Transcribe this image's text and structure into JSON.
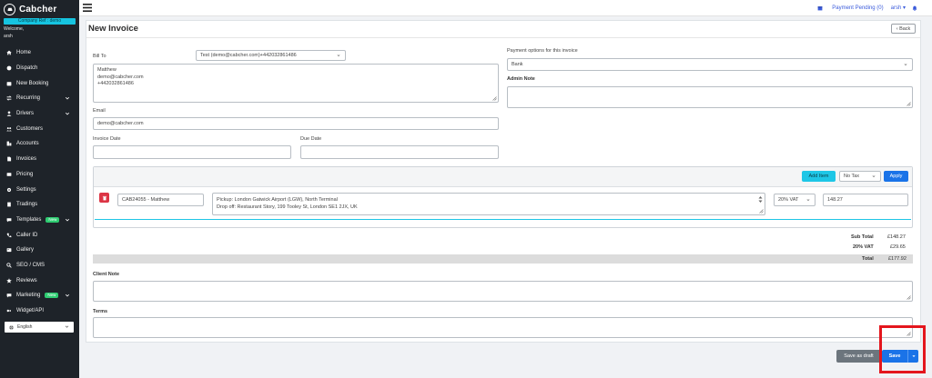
{
  "brand": {
    "name": "Cabcher"
  },
  "sidebar": {
    "company_ref": "Company Ref : demo",
    "welcome": "Welcome,",
    "username": "arsh",
    "items": [
      {
        "label": "Home",
        "icon": "home-icon"
      },
      {
        "label": "Dispatch",
        "icon": "dispatch-icon"
      },
      {
        "label": "New Booking",
        "icon": "new-booking-icon"
      },
      {
        "label": "Recurring",
        "icon": "recurring-icon",
        "has_children": true
      },
      {
        "label": "Drivers",
        "icon": "drivers-icon",
        "has_children": true
      },
      {
        "label": "Customers",
        "icon": "customers-icon"
      },
      {
        "label": "Accounts",
        "icon": "accounts-icon"
      },
      {
        "label": "Invoices",
        "icon": "invoices-icon"
      },
      {
        "label": "Pricing",
        "icon": "pricing-icon"
      },
      {
        "label": "Settings",
        "icon": "settings-icon"
      },
      {
        "label": "Tradings",
        "icon": "tradings-icon"
      },
      {
        "label": "Templates",
        "icon": "templates-icon",
        "badge": "New",
        "has_children": true
      },
      {
        "label": "Caller ID",
        "icon": "caller-id-icon"
      },
      {
        "label": "Gallery",
        "icon": "gallery-icon"
      },
      {
        "label": "SEO / CMS",
        "icon": "seo-icon"
      },
      {
        "label": "Reviews",
        "icon": "reviews-icon"
      },
      {
        "label": "Marketing",
        "icon": "marketing-icon",
        "badge": "New",
        "has_children": true
      },
      {
        "label": "Widget/API",
        "icon": "widget-icon"
      }
    ],
    "language": "English"
  },
  "topbar": {
    "payment_pending": "Payment Pending (0)",
    "user": "arsh"
  },
  "page": {
    "title": "New Invoice",
    "back_label": "Back"
  },
  "form": {
    "bill_to_label": "Bill To",
    "bill_to_value": "Test (demo@cabcher.com)+442032861486",
    "address_lines": [
      "Matthew",
      "demo@cabcher.com",
      "+442032861486"
    ],
    "email_label": "Email",
    "email_value": "demo@cabcher.com",
    "invoice_date_label": "Invoice Date",
    "invoice_date_value": "",
    "due_date_label": "Due Date",
    "due_date_value": "",
    "payment_options_label": "Payment options for this invoice",
    "payment_option_value": "Bank",
    "admin_note_label": "Admin Note",
    "admin_note_value": ""
  },
  "items": {
    "add_item_label": "Add Item",
    "tax_select_value": "No Tax",
    "apply_label": "Apply",
    "rows": [
      {
        "ref": "CAB24055 - Matthew",
        "description": [
          "Pickup: London Gatwick Airport (LGW), North Terminal",
          "Drop off: Restaurant Story, 199 Tooley St, London SE1 2JX, UK"
        ],
        "vat": "20% VAT",
        "amount": "148.27"
      }
    ]
  },
  "totals": {
    "subtotal_label": "Sub Total",
    "subtotal_value": "£148.27",
    "vat_label": "20% VAT",
    "vat_value": "£29.65",
    "total_label": "Total",
    "total_value": "£177.92"
  },
  "notes": {
    "client_note_label": "Client Note",
    "terms_label": "Terms"
  },
  "actions": {
    "save_draft_label": "Save as draft",
    "save_label": "Save"
  },
  "colors": {
    "sidebar_bg": "#1e2329",
    "accent_cyan": "#1ec6e6",
    "primary_blue": "#1a73e8",
    "highlight_red": "#e4161d"
  }
}
